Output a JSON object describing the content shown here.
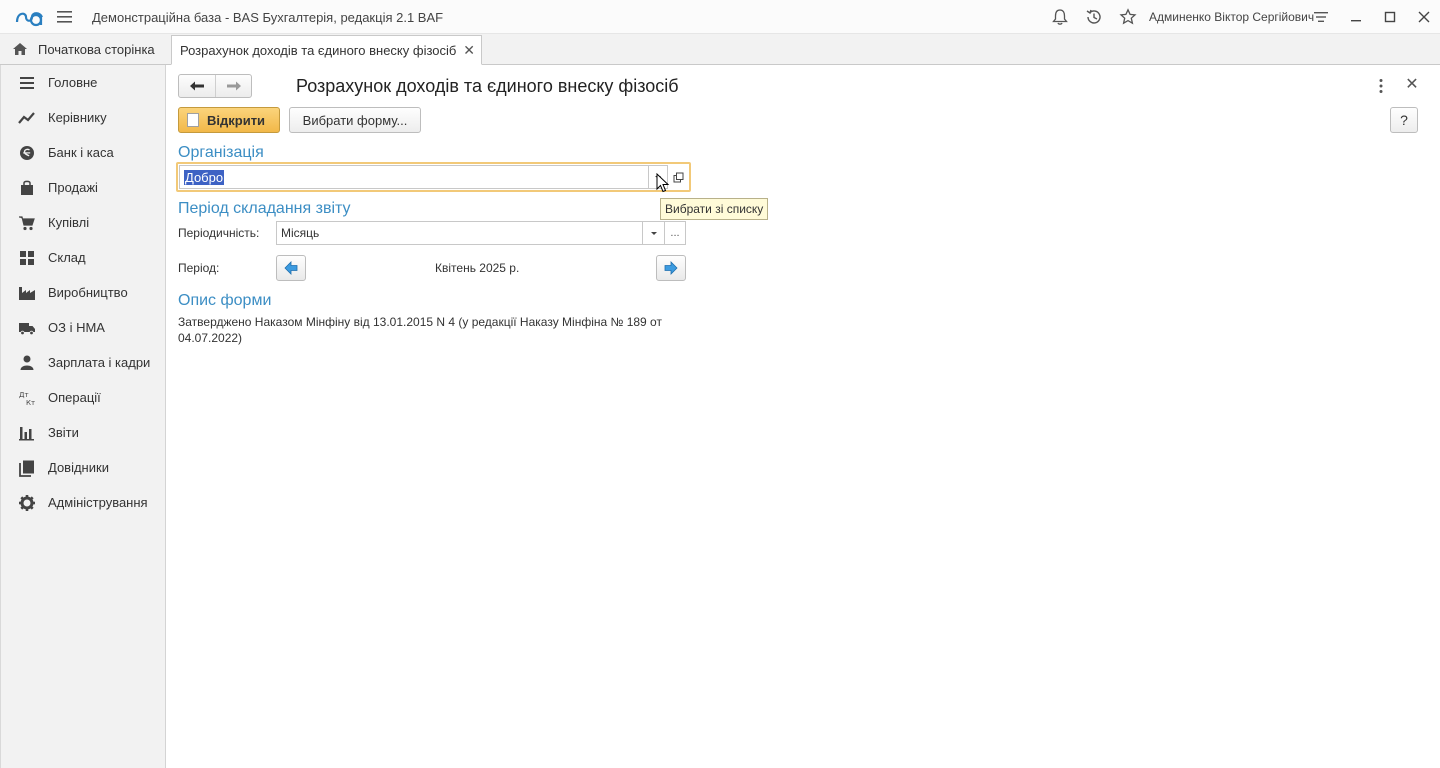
{
  "app": {
    "title": "Демонстраційна база - BAS Бухгалтерія, редакція 2.1 BAF",
    "user": "Админенко Віктор Сергійович"
  },
  "tabs": {
    "home": "Початкова сторінка",
    "active": "Розрахунок доходів та єдиного внеску фізосіб"
  },
  "sidebar": {
    "items": [
      {
        "label": "Головне",
        "icon": "list-icon"
      },
      {
        "label": "Керівнику",
        "icon": "trend-icon"
      },
      {
        "label": "Банк і каса",
        "icon": "coin-icon"
      },
      {
        "label": "Продажі",
        "icon": "bag-icon"
      },
      {
        "label": "Купівлі",
        "icon": "cart-icon"
      },
      {
        "label": "Склад",
        "icon": "grid-icon"
      },
      {
        "label": "Виробництво",
        "icon": "factory-icon"
      },
      {
        "label": "ОЗ і НМА",
        "icon": "truck-icon"
      },
      {
        "label": "Зарплата і кадри",
        "icon": "person-icon"
      },
      {
        "label": "Операції",
        "icon": "dt-kt-icon"
      },
      {
        "label": "Звіти",
        "icon": "bar-chart-icon"
      },
      {
        "label": "Довідники",
        "icon": "books-icon"
      },
      {
        "label": "Адміністрування",
        "icon": "gear-icon"
      }
    ]
  },
  "form": {
    "title": "Розрахунок доходів та єдиного внеску фізосіб",
    "open_button": "Відкрити",
    "choose_form_button": "Вибрати форму...",
    "help_button": "?",
    "org_section": "Організація",
    "org_value": "Добро",
    "tooltip": "Вибрати зі списку",
    "period_section": "Період складання звіту",
    "periodicity_label": "Періодичність:",
    "periodicity_value": "Місяць",
    "period_label": "Період:",
    "period_value": "Квітень 2025 р.",
    "desc_section": "Опис форми",
    "desc_text": "Затверджено Наказом Мінфіну від 13.01.2015 N 4 (у редакції Наказу Мінфіна № 189 от 04.07.2022)"
  },
  "colors": {
    "accent": "#3c8ec4",
    "primary_button": "#f2b849",
    "focus_border": "#f2c978"
  }
}
